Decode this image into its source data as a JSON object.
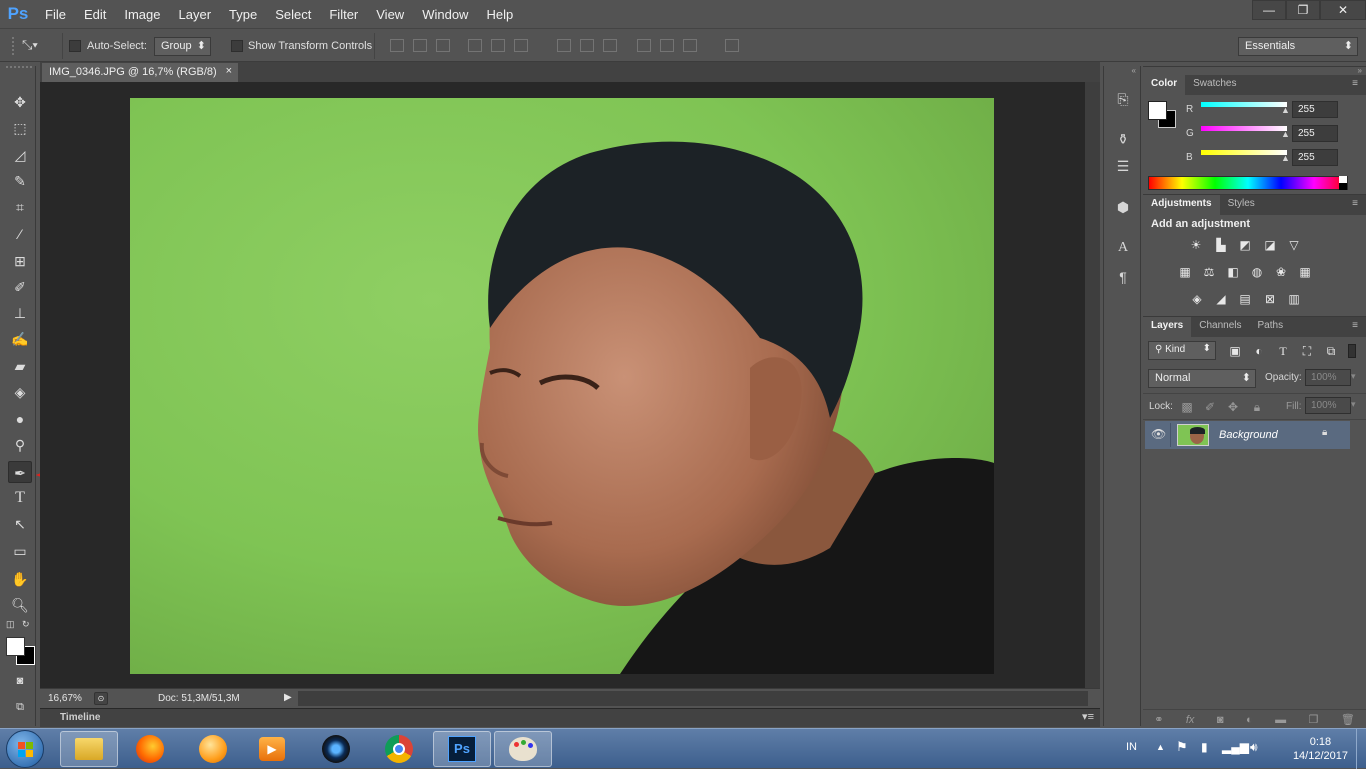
{
  "menubar": {
    "logo": "Ps",
    "items": [
      "File",
      "Edit",
      "Image",
      "Layer",
      "Type",
      "Select",
      "Filter",
      "View",
      "Window",
      "Help"
    ]
  },
  "window_controls": {
    "minimize": "—",
    "restore": "❐",
    "close": "✕"
  },
  "options": {
    "auto_select_label": "Auto-Select:",
    "auto_select_value": "Group",
    "show_transform_label": "Show Transform Controls",
    "workspace": "Essentials"
  },
  "document": {
    "tab_title": "IMG_0346.JPG @ 16,7% (RGB/8)",
    "tab_close": "×",
    "zoom": "16,67%",
    "doc_size": "Doc: 51,3M/51,3M",
    "timeline_label": "Timeline"
  },
  "color_panel": {
    "tabs": [
      "Color",
      "Swatches"
    ],
    "channels": [
      {
        "label": "R",
        "value": "255",
        "color": "#00ffff"
      },
      {
        "label": "G",
        "value": "255",
        "color": "#ff00ff"
      },
      {
        "label": "B",
        "value": "255",
        "color": "#ffff00"
      }
    ]
  },
  "adjustments_panel": {
    "tabs": [
      "Adjustments",
      "Styles"
    ],
    "heading": "Add an adjustment"
  },
  "layers_panel": {
    "tabs": [
      "Layers",
      "Channels",
      "Paths"
    ],
    "filter_kind": "Kind",
    "blend_mode": "Normal",
    "opacity_label": "Opacity:",
    "opacity_value": "100%",
    "lock_label": "Lock:",
    "fill_label": "Fill:",
    "fill_value": "100%",
    "layers": [
      {
        "name": "Background",
        "visible": true,
        "locked": true
      }
    ]
  },
  "taskbar": {
    "language": "IN",
    "time": "0:18",
    "date": "14/12/2017",
    "apps": [
      "file-explorer",
      "firefox",
      "browser",
      "media-player",
      "camera",
      "chrome",
      "photoshop",
      "paint"
    ]
  },
  "colors": {
    "ui_bg": "#535353",
    "canvas_bg": "#282828",
    "accent": "#4fa3ff",
    "annotation_arrow": "#e0201a"
  }
}
